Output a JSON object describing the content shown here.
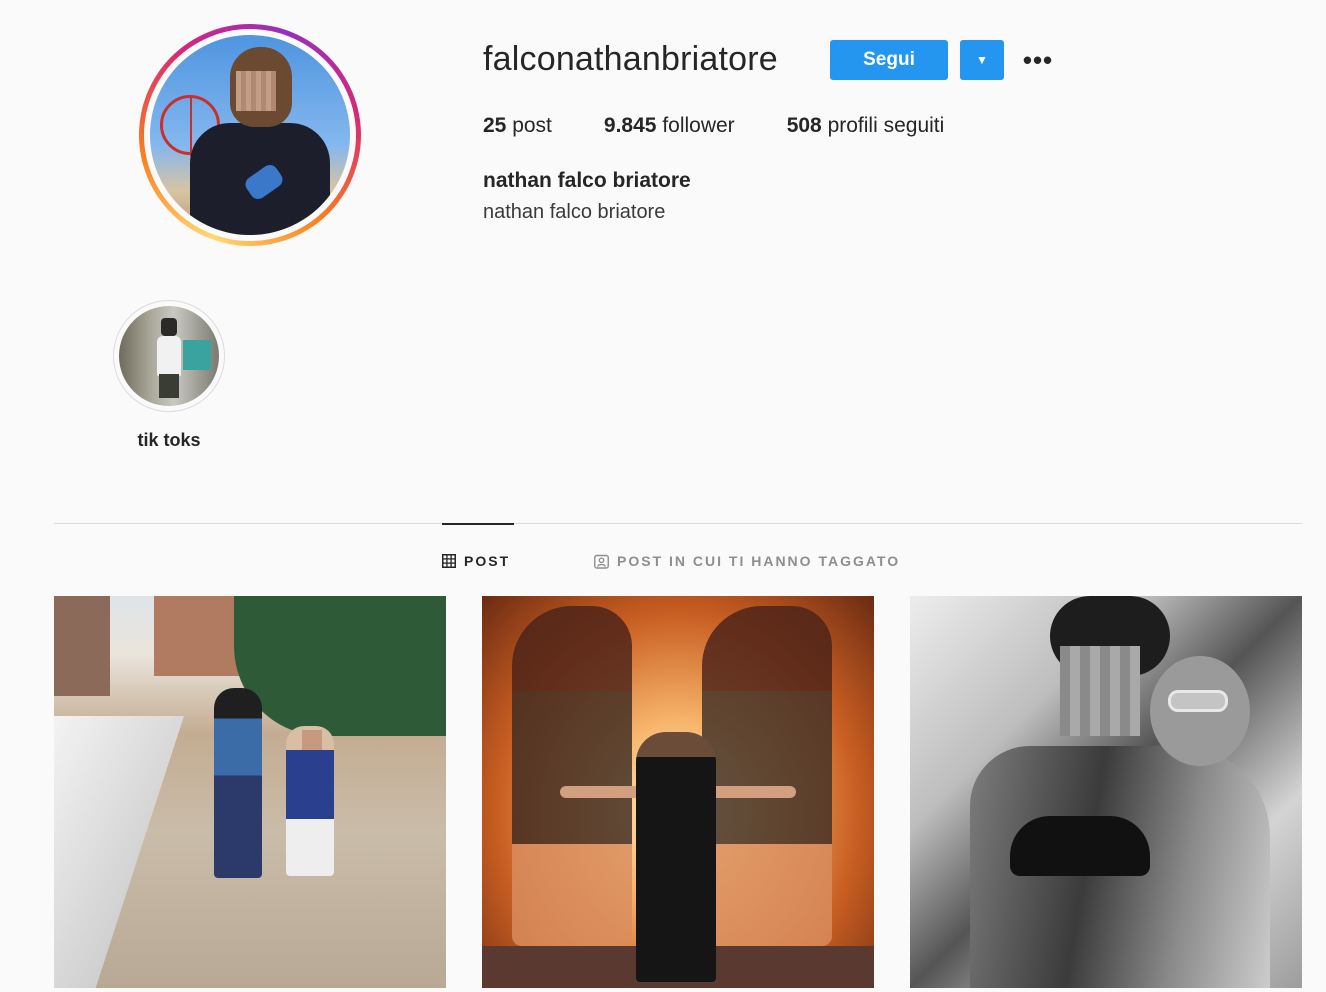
{
  "profile": {
    "username": "falconathanbriatore",
    "follow_label": "Segui",
    "dropdown_icon": "caret-down-icon",
    "more_label": "•••",
    "stats": {
      "posts_count": "25",
      "posts_label": "post",
      "followers_count": "9.845",
      "followers_label": "follower",
      "following_count": "508",
      "following_label": "profili seguiti"
    },
    "full_name": "nathan falco briatore",
    "bio": "nathan falco briatore"
  },
  "highlights": [
    {
      "label": "tik toks"
    }
  ],
  "tabs": {
    "post_label": "POST",
    "tagged_label": "POST IN CUI TI HANNO TAGGATO"
  },
  "colors": {
    "accent": "#2596f0",
    "text": "#262626",
    "muted": "#8e8e8e",
    "background": "#fafafa"
  }
}
